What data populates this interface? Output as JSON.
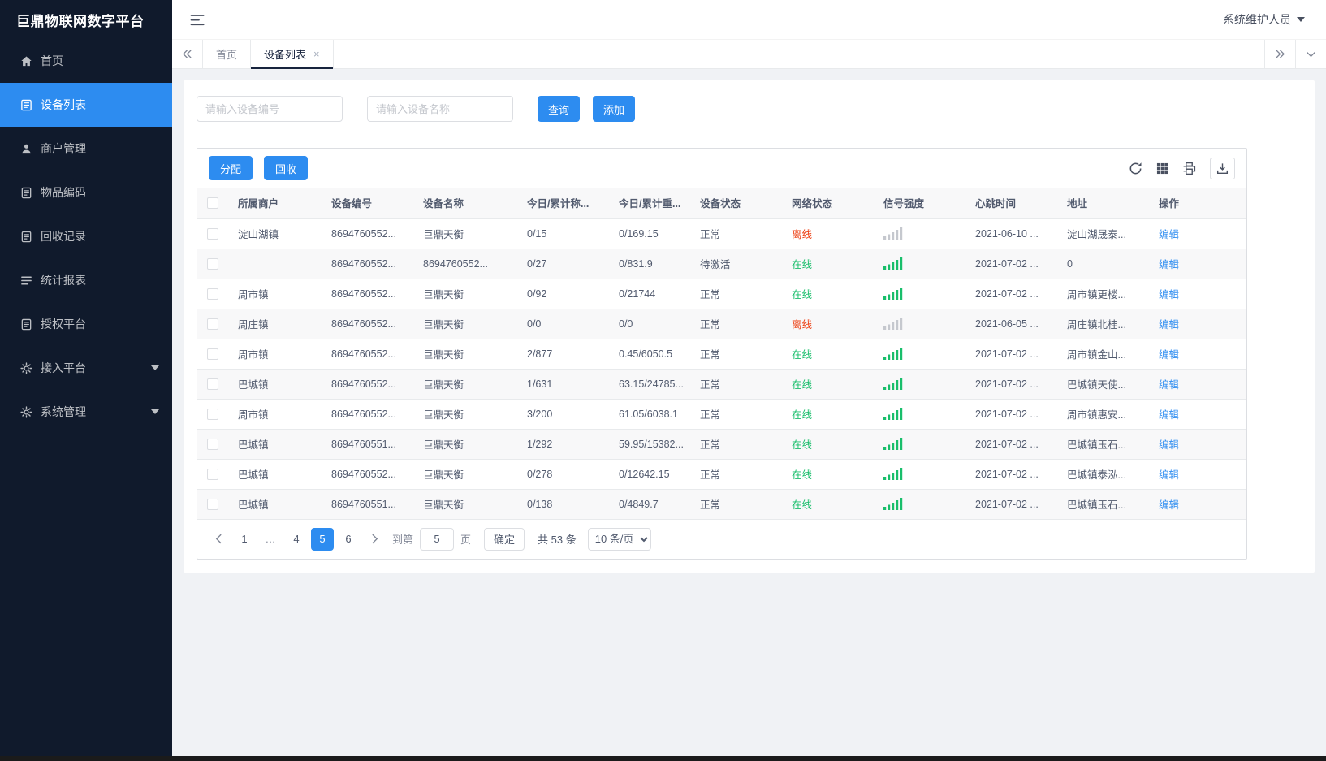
{
  "app": {
    "title": "巨鼎物联网数字平台",
    "user_name": "系统维护人员"
  },
  "sidebar": {
    "items": [
      {
        "name": "home",
        "icon": "home",
        "label": "首页",
        "active": false,
        "expandable": false
      },
      {
        "name": "device-list",
        "icon": "list",
        "label": "设备列表",
        "active": true,
        "expandable": false
      },
      {
        "name": "merchant-management",
        "icon": "person",
        "label": "商户管理",
        "active": false,
        "expandable": false
      },
      {
        "name": "item-coding",
        "icon": "doc",
        "label": "物品编码",
        "active": false,
        "expandable": false
      },
      {
        "name": "recycle-records",
        "icon": "doc",
        "label": "回收记录",
        "active": false,
        "expandable": false
      },
      {
        "name": "statistics-report",
        "icon": "menu",
        "label": "统计报表",
        "active": false,
        "expandable": false
      },
      {
        "name": "authorization-platform",
        "icon": "doc",
        "label": "授权平台",
        "active": false,
        "expandable": false
      },
      {
        "name": "access-platform",
        "icon": "gear",
        "label": "接入平台",
        "active": false,
        "expandable": true
      },
      {
        "name": "system-management",
        "icon": "gear",
        "label": "系统管理",
        "active": false,
        "expandable": true
      }
    ]
  },
  "tabbar": {
    "tabs": [
      {
        "name": "home",
        "label": "首页",
        "active": false,
        "closable": false
      },
      {
        "name": "device-list",
        "label": "设备列表",
        "active": true,
        "closable": true
      }
    ]
  },
  "filters": {
    "device_no_placeholder": "请输入设备编号",
    "device_name_placeholder": "请输入设备名称",
    "query_label": "查询",
    "add_label": "添加"
  },
  "toolbar": {
    "assign_label": "分配",
    "recycle_label": "回收"
  },
  "table": {
    "headers": [
      "所属商户",
      "设备编号",
      "设备名称",
      "今日/累计称...",
      "今日/累计重...",
      "设备状态",
      "网络状态",
      "信号强度",
      "心跳时间",
      "地址",
      "操作"
    ],
    "rows": [
      {
        "merchant": "淀山湖镇",
        "device_no": "8694760552...",
        "device_name": "巨鼎天衡",
        "today_count": "0/15",
        "today_weight": "0/169.15",
        "device_status": "正常",
        "network_status": "离线",
        "online": false,
        "signal": "weak",
        "heartbeat": "2021-06-10 ...",
        "address": "淀山湖晟泰...",
        "action": "编辑"
      },
      {
        "merchant": "",
        "device_no": "8694760552...",
        "device_name": "8694760552...",
        "today_count": "0/27",
        "today_weight": "0/831.9",
        "device_status": "待激活",
        "network_status": "在线",
        "online": true,
        "signal": "strong",
        "heartbeat": "2021-07-02 ...",
        "address": "0",
        "action": "编辑"
      },
      {
        "merchant": "周市镇",
        "device_no": "8694760552...",
        "device_name": "巨鼎天衡",
        "today_count": "0/92",
        "today_weight": "0/21744",
        "device_status": "正常",
        "network_status": "在线",
        "online": true,
        "signal": "strong",
        "heartbeat": "2021-07-02 ...",
        "address": "周市镇更楼...",
        "action": "编辑"
      },
      {
        "merchant": "周庄镇",
        "device_no": "8694760552...",
        "device_name": "巨鼎天衡",
        "today_count": "0/0",
        "today_weight": "0/0",
        "device_status": "正常",
        "network_status": "离线",
        "online": false,
        "signal": "weak",
        "heartbeat": "2021-06-05 ...",
        "address": "周庄镇北桂...",
        "action": "编辑"
      },
      {
        "merchant": "周市镇",
        "device_no": "8694760552...",
        "device_name": "巨鼎天衡",
        "today_count": "2/877",
        "today_weight": "0.45/6050.5",
        "device_status": "正常",
        "network_status": "在线",
        "online": true,
        "signal": "strong",
        "heartbeat": "2021-07-02 ...",
        "address": "周市镇金山...",
        "action": "编辑"
      },
      {
        "merchant": "巴城镇",
        "device_no": "8694760552...",
        "device_name": "巨鼎天衡",
        "today_count": "1/631",
        "today_weight": "63.15/24785...",
        "device_status": "正常",
        "network_status": "在线",
        "online": true,
        "signal": "strong",
        "heartbeat": "2021-07-02 ...",
        "address": "巴城镇天使...",
        "action": "编辑"
      },
      {
        "merchant": "周市镇",
        "device_no": "8694760552...",
        "device_name": "巨鼎天衡",
        "today_count": "3/200",
        "today_weight": "61.05/6038.1",
        "device_status": "正常",
        "network_status": "在线",
        "online": true,
        "signal": "strong",
        "heartbeat": "2021-07-02 ...",
        "address": "周市镇惠安...",
        "action": "编辑"
      },
      {
        "merchant": "巴城镇",
        "device_no": "8694760551...",
        "device_name": "巨鼎天衡",
        "today_count": "1/292",
        "today_weight": "59.95/15382...",
        "device_status": "正常",
        "network_status": "在线",
        "online": true,
        "signal": "strong",
        "heartbeat": "2021-07-02 ...",
        "address": "巴城镇玉石...",
        "action": "编辑"
      },
      {
        "merchant": "巴城镇",
        "device_no": "8694760552...",
        "device_name": "巨鼎天衡",
        "today_count": "0/278",
        "today_weight": "0/12642.15",
        "device_status": "正常",
        "network_status": "在线",
        "online": true,
        "signal": "strong",
        "heartbeat": "2021-07-02 ...",
        "address": "巴城镇泰泓...",
        "action": "编辑"
      },
      {
        "merchant": "巴城镇",
        "device_no": "8694760551...",
        "device_name": "巨鼎天衡",
        "today_count": "0/138",
        "today_weight": "0/4849.7",
        "device_status": "正常",
        "network_status": "在线",
        "online": true,
        "signal": "strong",
        "heartbeat": "2021-07-02 ...",
        "address": "巴城镇玉石...",
        "action": "编辑"
      }
    ]
  },
  "pagination": {
    "pages": [
      "1",
      "...",
      "4",
      "5",
      "6"
    ],
    "active_page": "5",
    "goto_prefix": "到第",
    "goto_value": "5",
    "goto_suffix": "页",
    "confirm_label": "确定",
    "total_text": "共 53 条",
    "page_size_option": "10 条/页"
  },
  "colors": {
    "primary": "#2d8cf0",
    "online_green": "#19be6b",
    "offline_red": "#ed4014",
    "weak_signal_gray": "#c5c8ce",
    "sidebar_bg": "#101a2c"
  }
}
